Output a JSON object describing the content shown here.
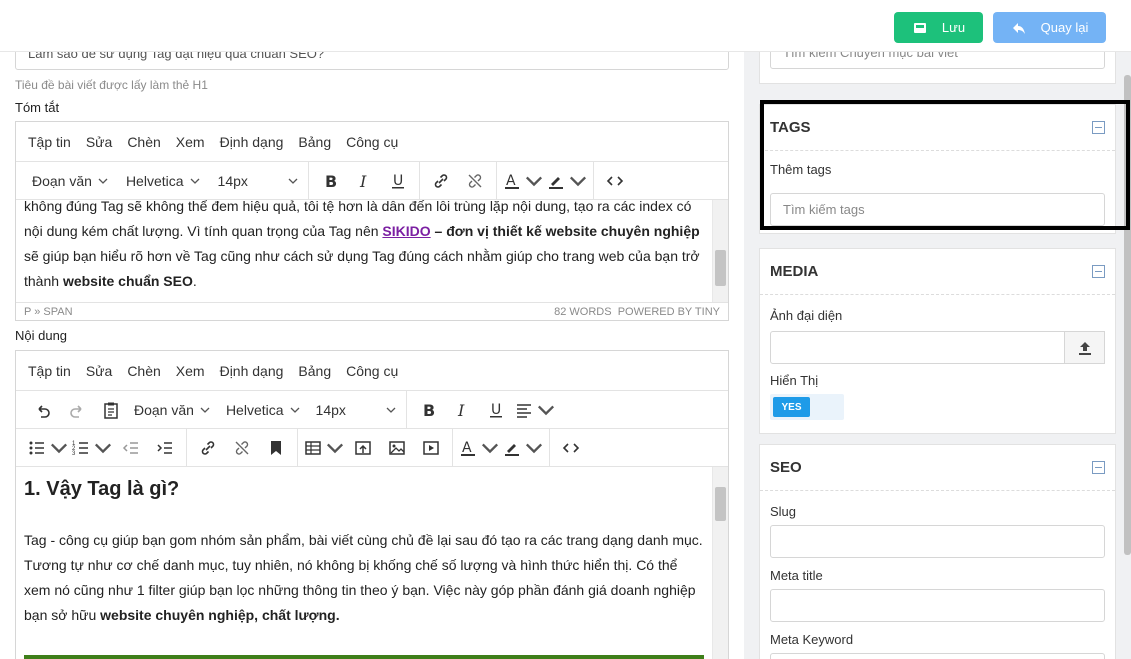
{
  "topbar": {
    "save_label": "Lưu",
    "back_label": "Quay lại"
  },
  "title_field": {
    "value": "Làm sao để sử dụng Tag đạt hiệu quả chuẩn SEO?",
    "hint": "Tiêu đề bài viết được lấy làm thẻ H1"
  },
  "summary": {
    "label": "Tóm tắt",
    "menu": [
      "Tập tin",
      "Sửa",
      "Chèn",
      "Xem",
      "Định dạng",
      "Bảng",
      "Công cụ"
    ],
    "format_select": "Đoạn văn",
    "font_select": "Helvetica",
    "size_select": "14px",
    "text_line1": "không đúng Tag sẽ không thể đem hiệu quả, tôi tệ hơn là dẫn đến lỗi trùng lặp nội dung, tạo ra các index có",
    "text_line2": "nội dung kém chất lượng. Vì tính quan trọng của Tag nên ",
    "link_text": "SIKIDO",
    "bold_text1": " – đơn vị thiết kế website chuyên nghiệp",
    "text_line3": "sẽ giúp bạn hiểu rõ hơn về Tag cũng như cách sử dụng Tag đúng cách nhằm giúp cho trang web của bạn trở",
    "text_line4a": "thành ",
    "bold_text2": "website chuẩn SEO",
    "text_line4b": ".",
    "path": "P » SPAN",
    "wordcount": "82 WORDS",
    "powered": "POWERED BY TINY"
  },
  "content": {
    "label": "Nội dung",
    "menu": [
      "Tập tin",
      "Sửa",
      "Chèn",
      "Xem",
      "Định dạng",
      "Bảng",
      "Công cụ"
    ],
    "format_select": "Đoạn văn",
    "font_select": "Helvetica",
    "size_select": "14px",
    "heading": "1. Vậy Tag là gì?",
    "p1": "Tag - công cụ giúp bạn gom nhóm sản phẩm, bài viết cùng chủ đề lại sau đó tạo ra các trang dạng danh mục.",
    "p2": "Tương tự như cơ chế danh mục, tuy nhiên, nó không bị khống chế số lượng và hình thức hiển thị. Có thể",
    "p3": "xem nó cũng như 1 filter giúp bạn lọc những thông tin theo ý bạn. Việc này góp phần đánh giá doanh nghiệp",
    "p4a": "bạn sở hữu ",
    "p4b": "website chuyên nghiệp, chất lượng."
  },
  "category": {
    "placeholder": "Tìm kiếm Chuyên mục bài viết"
  },
  "tags": {
    "title": "TAGS",
    "label": "Thêm tags",
    "placeholder": "Tìm kiếm tags"
  },
  "media": {
    "title": "MEDIA",
    "image_label": "Ảnh đại diện",
    "display_label": "Hiển Thị",
    "toggle": "YES"
  },
  "seo": {
    "title": "SEO",
    "slug_label": "Slug",
    "meta_title_label": "Meta title",
    "meta_keyword_label": "Meta Keyword"
  },
  "colors": {
    "save": "#1dc17b",
    "back": "#74b3f5",
    "toggle": "#1e9be8",
    "link": "#7b1fa2"
  }
}
